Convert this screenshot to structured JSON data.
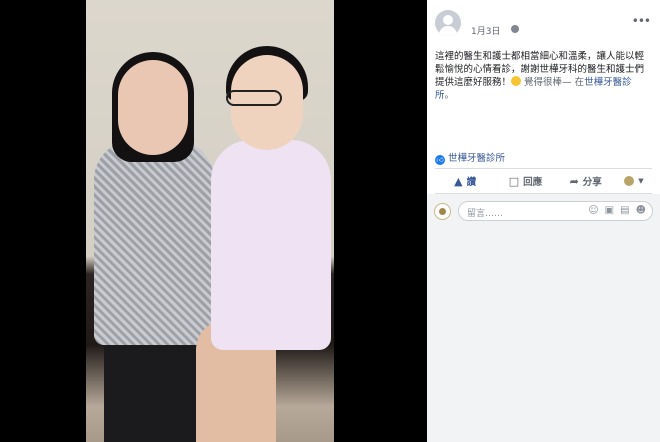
{
  "post": {
    "date": "1月3日",
    "text": "這裡的醫生和護士都相當細心和溫柔，讓人能以輕鬆愉悅的心情看診，謝謝世樺牙科的醫生和護士們提供這麼好服務！",
    "feeling": "覺得很棒",
    "location_prefix": "— 在",
    "location": "世樺牙醫診所",
    "location_suffix": "。"
  },
  "reactions": {
    "liker": "世樺牙醫診所"
  },
  "actions": {
    "like": "讚",
    "comment": "回應",
    "share": "分享"
  },
  "comment": {
    "placeholder": "留言……"
  },
  "icons": {
    "like": "thumbs-up-icon",
    "comment": "speech-bubble-icon",
    "share": "share-arrow-icon",
    "privacy": "globe-icon",
    "more": "more-dots-icon",
    "emoji": "emoji-icon",
    "camera": "camera-icon",
    "gif": "gif-icon",
    "sticker": "sticker-icon"
  },
  "colors": {
    "link": "#385898",
    "like_badge": "#1877f2"
  }
}
